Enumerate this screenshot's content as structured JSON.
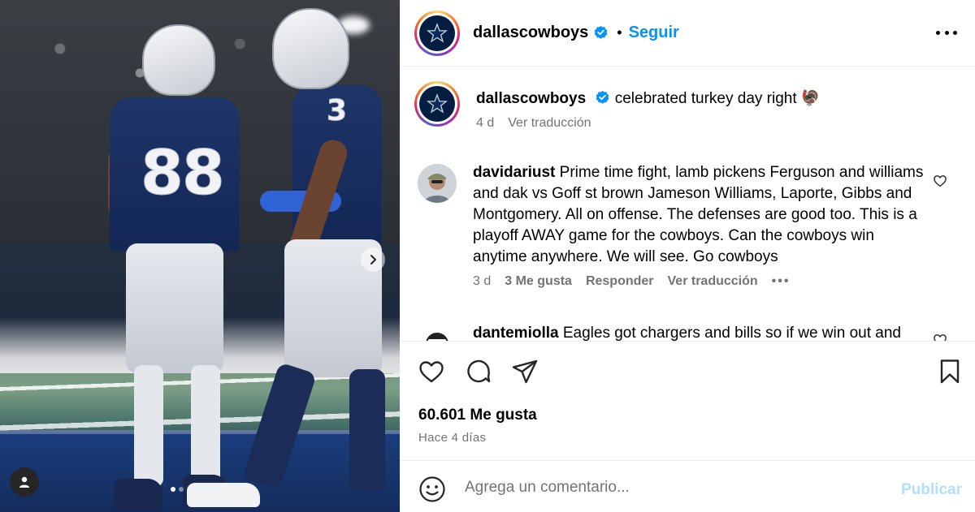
{
  "media": {
    "jersey_numbers": [
      "88",
      "3"
    ]
  },
  "header": {
    "username": "dallascowboys",
    "separator": "•",
    "follow_label": "Seguir"
  },
  "caption": {
    "username": "dallascowboys",
    "text": "celebrated turkey day right",
    "emoji": "🦃",
    "time": "4 d",
    "translate_label": "Ver traducción"
  },
  "comments": [
    {
      "username": "davidariust",
      "text": "Prime time fight, lamb pickens Ferguson and williams and dak vs Goff st brown Jameson Williams, Laporte, Gibbs and Montgomery. All on offense. The defenses are good too. This is a playoff AWAY game for the cowboys. Can the cowboys win anytime anywhere. We will see. Go cowboys",
      "time": "3 d",
      "likes": "3 Me gusta",
      "reply_label": "Responder",
      "translate_label": "Ver traducción",
      "more": "•••"
    },
    {
      "username": "dantemiolla",
      "text": "Eagles got chargers and bills so if we win out and"
    }
  ],
  "actions": {
    "likes_count": "60.601 Me gusta",
    "posted_ago": "Hace 4 días"
  },
  "composer": {
    "placeholder": "Agrega un comentario...",
    "publish_label": "Publicar"
  },
  "colors": {
    "accent": "#0095f6",
    "publish_disabled": "#b2dffc",
    "cowboys_navy": "#041e42"
  }
}
